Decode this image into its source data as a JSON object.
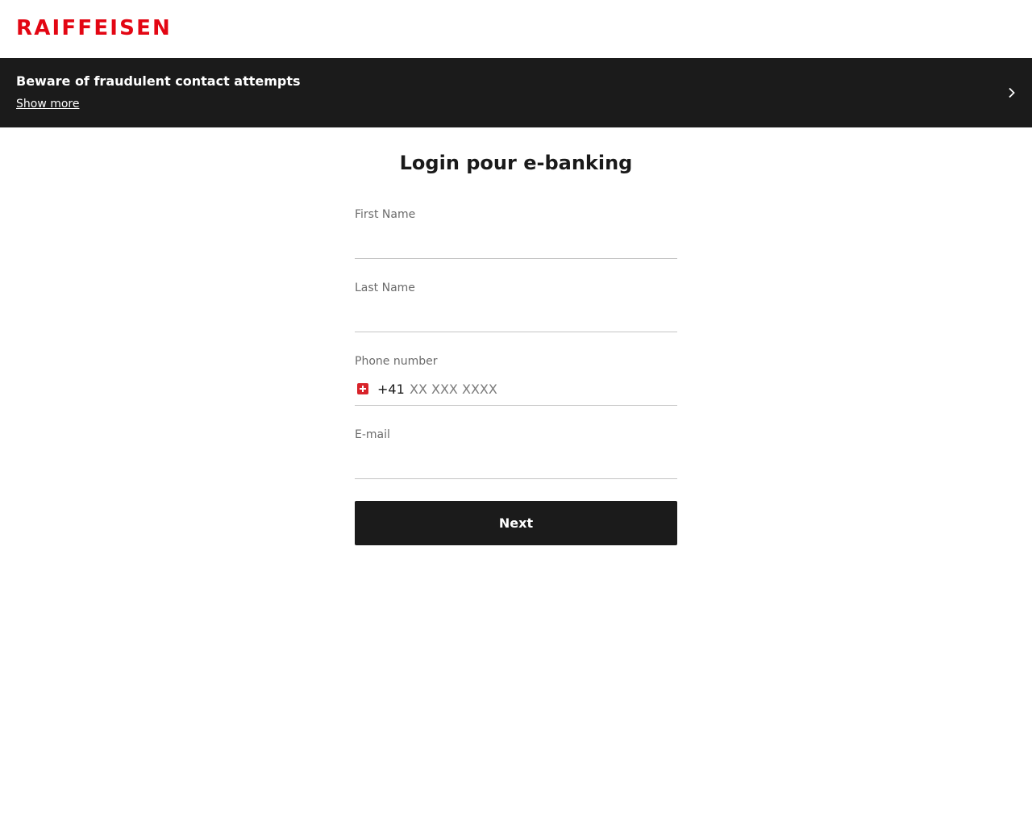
{
  "brand": {
    "logo_text": "RAIFFEISEN",
    "color": "#e30613"
  },
  "banner": {
    "title": "Beware of fraudulent contact attempts",
    "link": "Show more",
    "icon": "chevron-right-icon",
    "background": "#1b1b1b"
  },
  "page": {
    "title": "Login pour e-banking"
  },
  "form": {
    "first_name": {
      "label": "First Name",
      "value": ""
    },
    "last_name": {
      "label": "Last Name",
      "value": ""
    },
    "phone": {
      "label": "Phone number",
      "country_code": "+41",
      "flag_icon": "swiss-flag-icon",
      "placeholder": "XX XXX XXXX",
      "value": ""
    },
    "email": {
      "label": "E-mail",
      "value": ""
    },
    "submit_label": "Next"
  }
}
